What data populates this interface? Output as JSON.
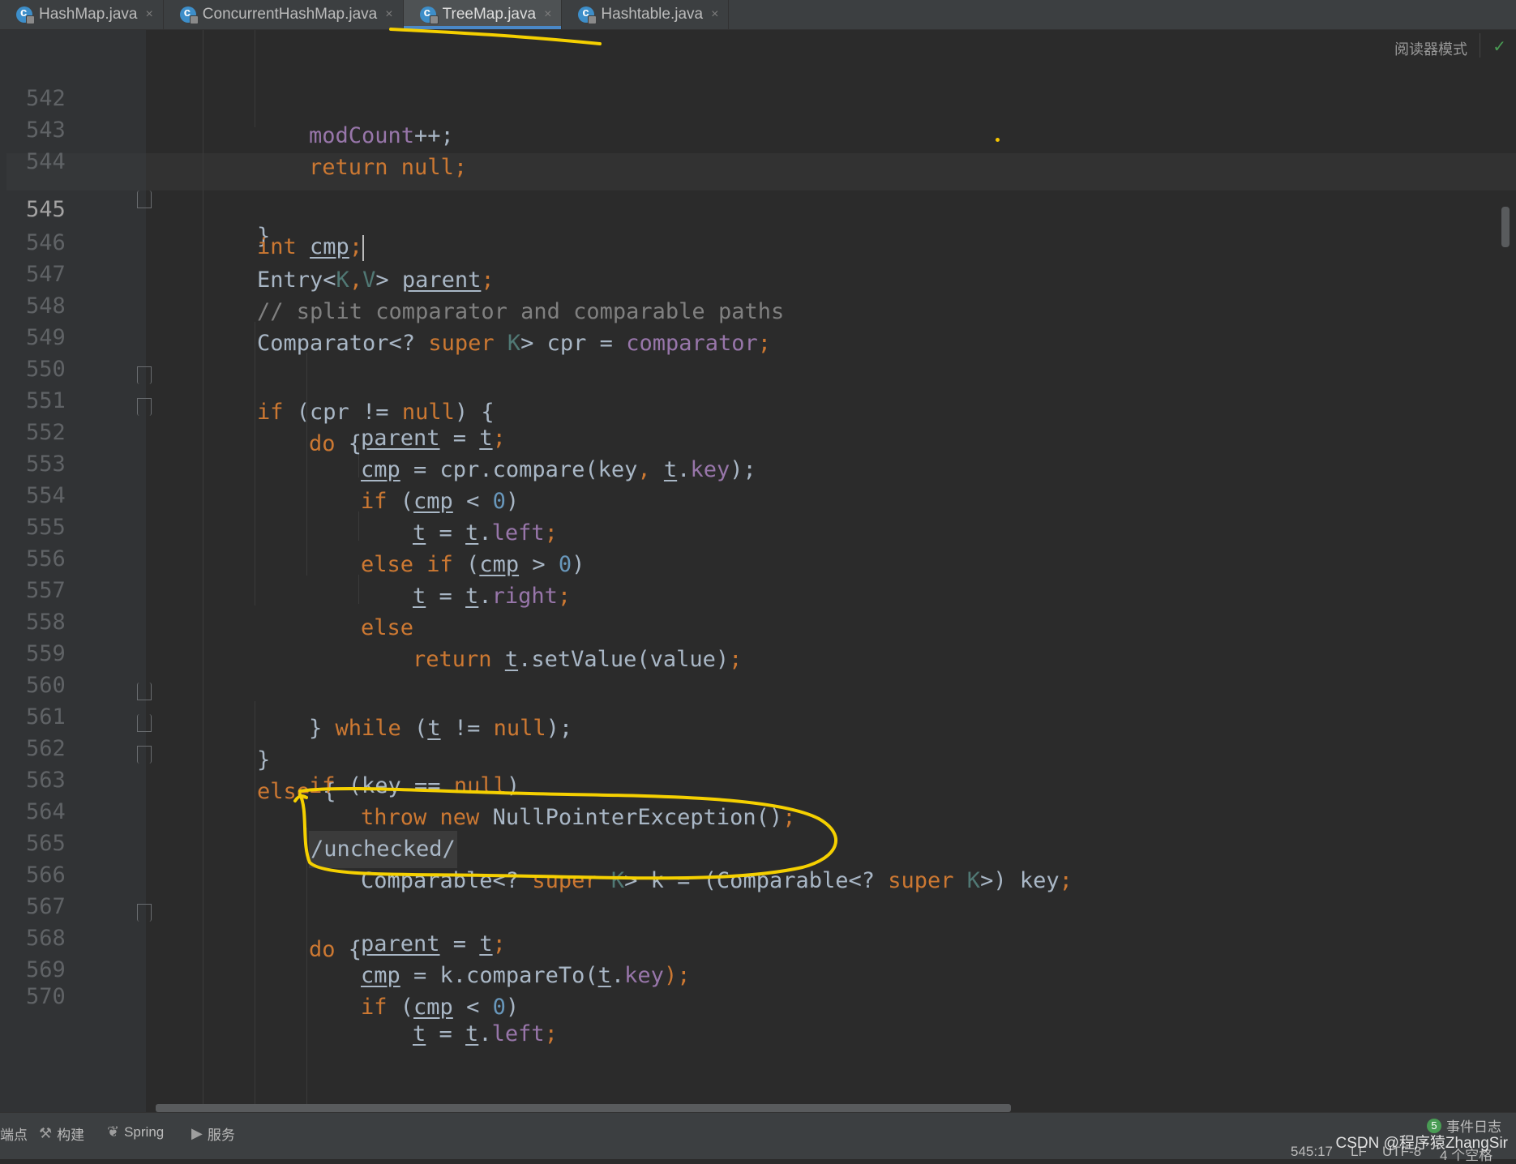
{
  "tabs": [
    {
      "label": "HashMap.java",
      "active": false
    },
    {
      "label": "ConcurrentHashMap.java",
      "active": false
    },
    {
      "label": "TreeMap.java",
      "active": true
    },
    {
      "label": "Hashtable.java",
      "active": false
    }
  ],
  "tab_close_glyph": "×",
  "reader_mode_label": "阅读器模式",
  "lines": [
    {
      "n": "542"
    },
    {
      "n": "543"
    },
    {
      "n": "544"
    },
    {
      "n": "545"
    },
    {
      "n": "546"
    },
    {
      "n": "547"
    },
    {
      "n": "548"
    },
    {
      "n": "549"
    },
    {
      "n": "550"
    },
    {
      "n": "551"
    },
    {
      "n": "552"
    },
    {
      "n": "553"
    },
    {
      "n": "554"
    },
    {
      "n": "555"
    },
    {
      "n": "556"
    },
    {
      "n": "557"
    },
    {
      "n": "558"
    },
    {
      "n": "559"
    },
    {
      "n": "560"
    },
    {
      "n": "561"
    },
    {
      "n": "562"
    },
    {
      "n": "563"
    },
    {
      "n": "564"
    },
    {
      "n": "565"
    },
    {
      "n": "566"
    },
    {
      "n": "567"
    },
    {
      "n": "568"
    },
    {
      "n": "569"
    },
    {
      "n": "570"
    }
  ],
  "code": {
    "l542": [
      "modCount",
      "++;"
    ],
    "l543": [
      "return",
      " null;"
    ],
    "l544": "}",
    "l545": [
      "int",
      " ",
      "cmp",
      ";"
    ],
    "l546": [
      "Entry<",
      "K",
      ",",
      "V",
      "> ",
      "parent",
      ";"
    ],
    "l547": "// split comparator and comparable paths",
    "l548": [
      "Comparator<? ",
      "super",
      " ",
      "K",
      "> cpr = ",
      "comparator",
      ";"
    ],
    "l549": [
      "if",
      " (cpr != ",
      "null",
      ") {"
    ],
    "l550": [
      "do",
      " {"
    ],
    "l551": [
      "parent",
      " = ",
      "t",
      ";"
    ],
    "l552": [
      "cmp",
      " = cpr.compare(key",
      ", ",
      "t",
      ".",
      "key",
      ");"
    ],
    "l553": [
      "if",
      " (",
      "cmp",
      " < ",
      "0",
      ")"
    ],
    "l554": [
      "t",
      " = ",
      "t",
      ".",
      "left",
      ";"
    ],
    "l555": [
      "else if",
      " (",
      "cmp",
      " > ",
      "0",
      ")"
    ],
    "l556": [
      "t",
      " = ",
      "t",
      ".",
      "right",
      ";"
    ],
    "l557": "else",
    "l558": [
      "return",
      " ",
      "t",
      ".setValue(value)",
      ";"
    ],
    "l559": [
      "} ",
      "while",
      " (",
      "t",
      " != ",
      "null",
      ");"
    ],
    "l560": "}",
    "l561": [
      "else",
      " {"
    ],
    "l562": [
      "if",
      " (key == ",
      "null",
      ")"
    ],
    "l563": [
      "throw new",
      " NullPointerException()",
      ";"
    ],
    "l564": "/unchecked/",
    "l565": [
      "Comparable<? ",
      "super",
      " ",
      "K",
      "> k = (Comparable<? ",
      "super",
      " ",
      "K",
      ">) key",
      ";"
    ],
    "l566": [
      "do",
      " {"
    ],
    "l567": [
      "parent",
      " = ",
      "t",
      ";"
    ],
    "l568": [
      "cmp",
      " = k.compareTo(",
      "t",
      ".",
      "key",
      ");"
    ],
    "l569": [
      "if",
      " (",
      "cmp",
      " < ",
      "0",
      ")"
    ],
    "l570": [
      "t",
      " = ",
      "t",
      ".",
      "left",
      ";"
    ]
  },
  "status": {
    "breakpoints": "端点",
    "build": "构建",
    "spring": "Spring",
    "services": "服务",
    "events_count": "5",
    "events_label": "事件日志",
    "position": "545:17",
    "line_sep": "LF",
    "encoding": "UTF-8",
    "indent": "4 个空格"
  },
  "watermark": "CSDN @程序猿ZhangSir",
  "colors": {
    "keyword": "#cc7832",
    "field": "#9876aa",
    "number": "#6897bb",
    "comment": "#808080",
    "text": "#a9b7c6",
    "annotation": "#f5d000",
    "active_tab_underline": "#4a88c7"
  }
}
